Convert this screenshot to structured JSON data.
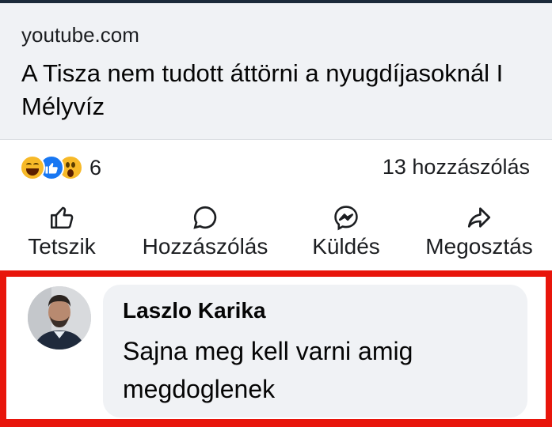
{
  "link_preview": {
    "domain": "youtube.com",
    "title": "A Tisza nem tudott áttörni a nyugdíjasoknál I Mélyvíz"
  },
  "reactions": {
    "icons": [
      "haha-icon",
      "like-icon",
      "wow-icon"
    ],
    "count": "6"
  },
  "comments_summary": "13 hozzászólás",
  "actions": {
    "like": "Tetszik",
    "comment": "Hozzászólás",
    "send": "Küldés",
    "share": "Megosztás"
  },
  "comment": {
    "author": "Laszlo Karika",
    "text": "Sajna meg kell varni amig megdoglenek"
  },
  "colors": {
    "card_background": "#f0f2f5",
    "highlight_border": "#e8150b",
    "like_blue": "#1877f2",
    "reaction_yellow": "#f7b928"
  }
}
